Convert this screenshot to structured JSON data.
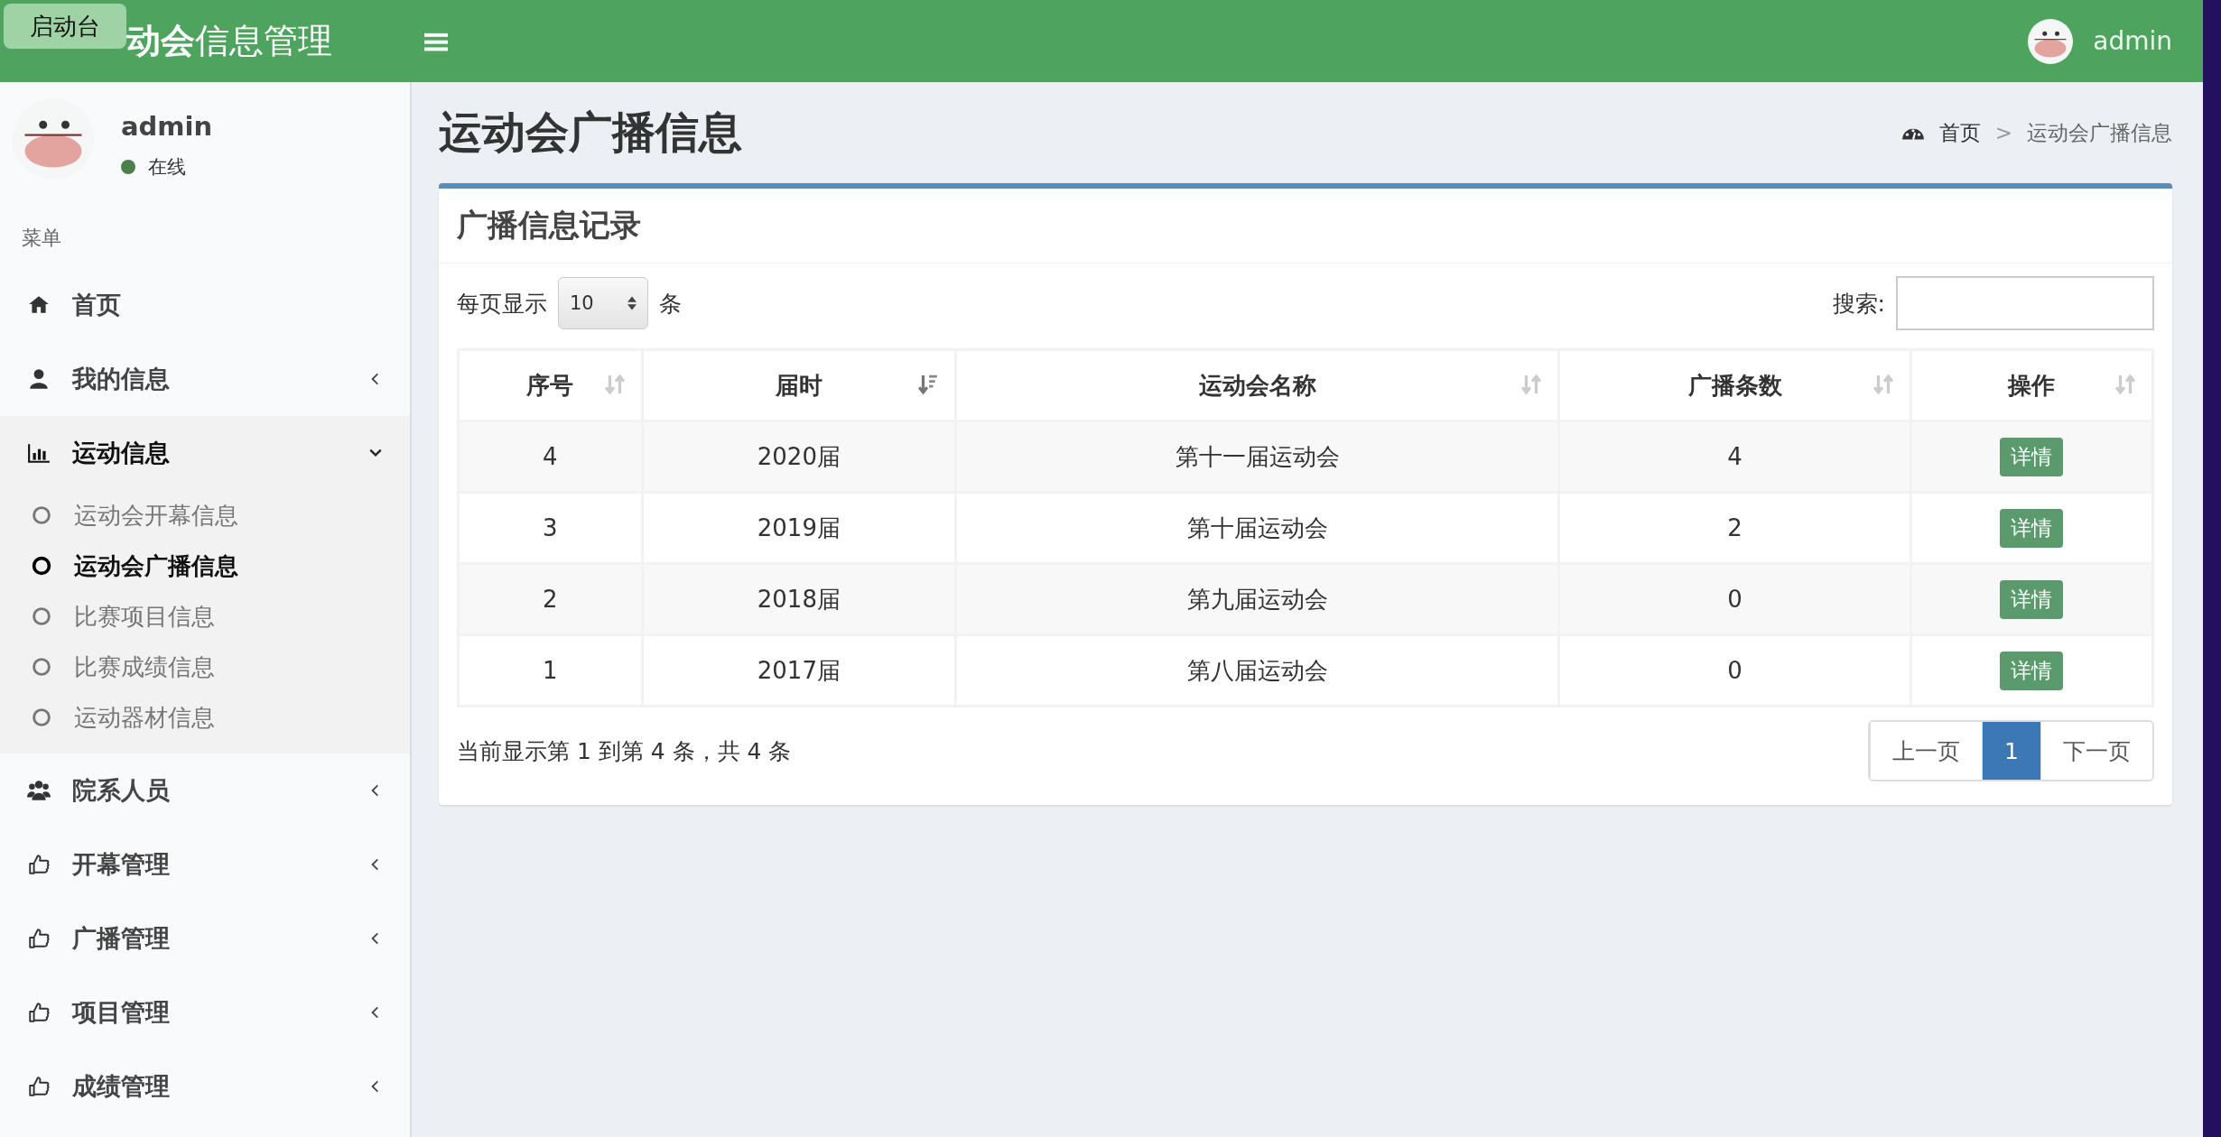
{
  "header": {
    "overlay_button": "启动台",
    "logo_bold": "动会",
    "logo_regular": "信息管理",
    "user_name": "admin"
  },
  "sidebar": {
    "user": {
      "name": "admin",
      "status": "在线",
      "online": true
    },
    "menu_label": "菜单",
    "items": [
      {
        "label": "首页",
        "kind": "link",
        "expanded": false
      },
      {
        "label": "我的信息",
        "kind": "group",
        "expanded": false
      },
      {
        "label": "运动信息",
        "kind": "group",
        "expanded": true,
        "children": [
          {
            "label": "运动会开幕信息",
            "selected": false
          },
          {
            "label": "运动会广播信息",
            "selected": true
          },
          {
            "label": "比赛项目信息",
            "selected": false
          },
          {
            "label": "比赛成绩信息",
            "selected": false
          },
          {
            "label": "运动器材信息",
            "selected": false
          }
        ]
      },
      {
        "label": "院系人员",
        "kind": "group",
        "expanded": false
      },
      {
        "label": "开幕管理",
        "kind": "group",
        "expanded": false
      },
      {
        "label": "广播管理",
        "kind": "group",
        "expanded": false
      },
      {
        "label": "项目管理",
        "kind": "group",
        "expanded": false
      },
      {
        "label": "成绩管理",
        "kind": "group",
        "expanded": false
      }
    ]
  },
  "page": {
    "title": "运动会广播信息",
    "breadcrumb": [
      "首页",
      "运动会广播信息"
    ],
    "breadcrumb_separator": ">"
  },
  "box": {
    "title": "广播信息记录",
    "length_label": "每页显示",
    "page_size": "10",
    "length_unit": "条",
    "search_label": "搜索:",
    "table": {
      "columns": [
        {
          "label": "序号",
          "sorted": false
        },
        {
          "label": "届时",
          "sorted": true
        },
        {
          "label": "运动会名称",
          "sorted": false
        },
        {
          "label": "广播条数",
          "sorted": false
        },
        {
          "label": "操作",
          "sorted": false
        }
      ],
      "rows": [
        {
          "cells": [
            "4",
            "2020届",
            "第十一届运动会",
            "4"
          ],
          "action": "详情"
        },
        {
          "cells": [
            "3",
            "2019届",
            "第十届运动会",
            "2"
          ],
          "action": "详情"
        },
        {
          "cells": [
            "2",
            "2018届",
            "第九届运动会",
            "0"
          ],
          "action": "详情"
        },
        {
          "cells": [
            "1",
            "2017届",
            "第八届运动会",
            "0"
          ],
          "action": "详情"
        }
      ]
    },
    "info": "当前显示第 1 到第 4 条，共 4 条",
    "pagination": [
      {
        "label": "上一页",
        "selected": false
      },
      {
        "label": "1",
        "selected": true
      },
      {
        "label": "下一页",
        "selected": false
      }
    ]
  }
}
